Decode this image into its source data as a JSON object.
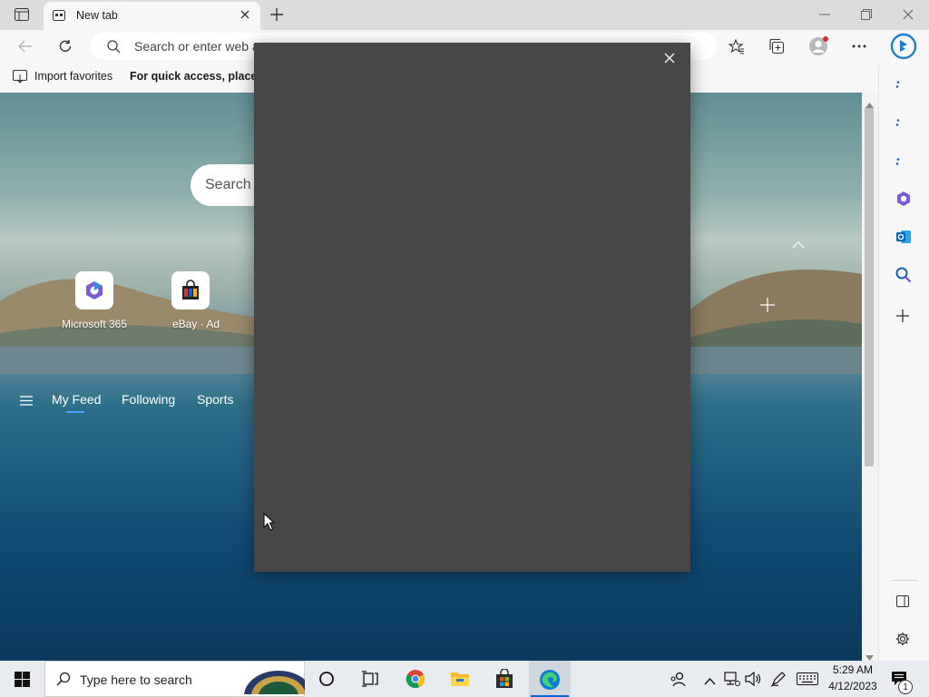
{
  "browser": {
    "tab_title": "New tab",
    "address_placeholder": "Search or enter web a"
  },
  "favorites_bar": {
    "import_label": "Import favorites",
    "hint_text": "For quick access, place yo"
  },
  "newtab": {
    "search_placeholder": "Search",
    "quick_links": [
      {
        "label": "Microsoft 365"
      },
      {
        "label": "eBay · Ad"
      }
    ],
    "feed_tabs": [
      {
        "label": "My Feed",
        "active": true
      },
      {
        "label": "Following"
      },
      {
        "label": "Sports"
      }
    ]
  },
  "taskbar": {
    "search_placeholder": "Type here to search",
    "time": "5:29 AM",
    "date": "4/12/2023",
    "notification_count": "1"
  },
  "colors": {
    "modal_bg": "#474747",
    "accent": "#0a64d8"
  }
}
